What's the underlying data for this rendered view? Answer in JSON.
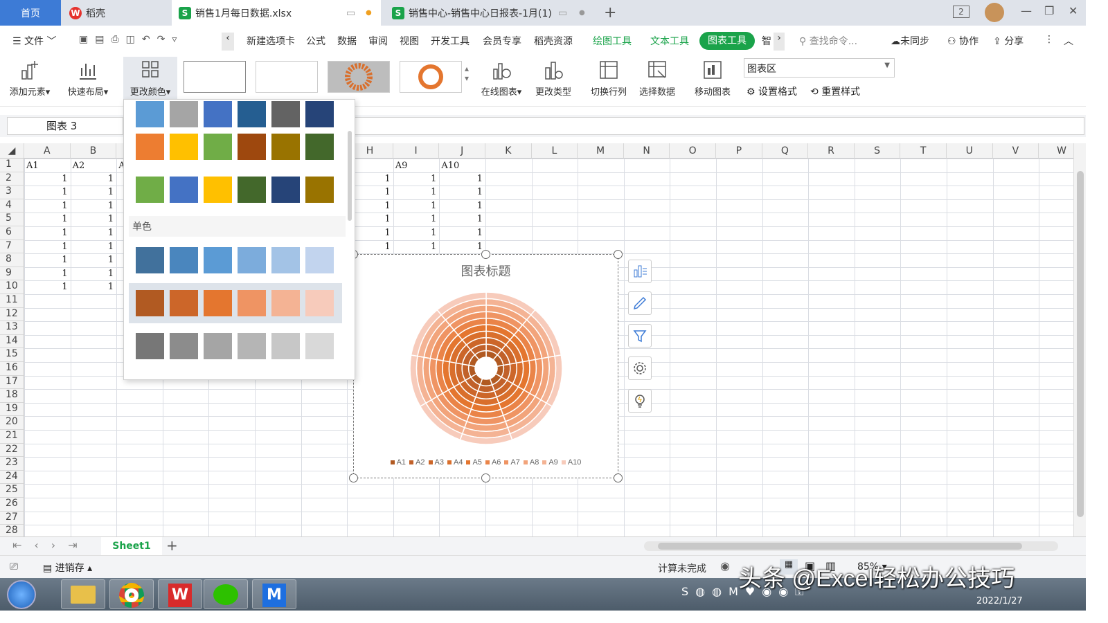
{
  "tabs": {
    "home": "首页",
    "daoke": "稻壳",
    "file1": "销售1月每日数据.xlsx",
    "file2": "销售中心-销售中心日报表-1月(1)",
    "add": "+"
  },
  "window": {
    "badge": "2"
  },
  "menu": {
    "file": "文件",
    "items": [
      "新建选项卡",
      "公式",
      "数据",
      "审阅",
      "视图",
      "开发工具",
      "会员专享",
      "稻壳资源"
    ],
    "draw_tools": "绘图工具",
    "text_tools": "文本工具",
    "chart_tools": "图表工具",
    "smart": "智",
    "search": "查找命令...",
    "unsync": "未同步",
    "collab": "协作",
    "share": "分享"
  },
  "ribbon": {
    "add_element": "添加元素",
    "quick_layout": "快速布局",
    "change_color": "更改颜色",
    "online_chart": "在线图表",
    "change_type": "更改类型",
    "switch_rowcol": "切换行列",
    "select_data": "选择数据",
    "move_chart": "移动图表",
    "chart_area": "图表区",
    "set_format": "设置格式",
    "reset_style": "重置样式"
  },
  "namebox": "图表 3",
  "columns": [
    "A",
    "B",
    "C",
    "D",
    "E",
    "F",
    "G",
    "H",
    "I",
    "J",
    "K",
    "L",
    "M",
    "N",
    "O",
    "P",
    "Q",
    "R",
    "S",
    "T",
    "U",
    "V",
    "W"
  ],
  "rows": [
    "1",
    "2",
    "3",
    "4",
    "5",
    "6",
    "7",
    "8",
    "9",
    "10",
    "11",
    "12",
    "13",
    "14",
    "15",
    "16",
    "17",
    "18",
    "19",
    "20",
    "21",
    "22",
    "23",
    "24",
    "25",
    "26",
    "27",
    "28"
  ],
  "cells": {
    "header_left": [
      "A1",
      "A2",
      "A"
    ],
    "header_right": [
      "8",
      "A9",
      "A10"
    ],
    "value": "1"
  },
  "dropdown": {
    "mono_label": "单色",
    "rows": [
      [
        "#5b9bd5",
        "#a5a5a5",
        "#4472c4",
        "#255e91",
        "#636363",
        "#264478"
      ],
      [
        "#ed7d31",
        "#ffc000",
        "#70ad47",
        "#9e480e",
        "#997300",
        "#43682b"
      ],
      [
        "#70ad47",
        "#4472c4",
        "#ffc000",
        "#43682b",
        "#264478",
        "#997300"
      ],
      [
        "#41719c",
        "#4a86be",
        "#5b9bd5",
        "#7cacdc",
        "#a3c3e6",
        "#c2d4ee"
      ],
      [
        "#b15a22",
        "#cc6629",
        "#e4762f",
        "#ef9463",
        "#f4b394",
        "#f7cbbb"
      ],
      [
        "#777777",
        "#8c8c8c",
        "#a5a5a5",
        "#b5b5b5",
        "#c7c7c7",
        "#d9d9d9"
      ]
    ]
  },
  "chart": {
    "title": "图表标题",
    "legend": [
      "A1",
      "A2",
      "A3",
      "A4",
      "A5",
      "A6",
      "A7",
      "A8",
      "A9",
      "A10"
    ],
    "ring_colors": [
      "#b15a22",
      "#c1612a",
      "#cc6629",
      "#d96f2c",
      "#e4762f",
      "#ea8448",
      "#ef9463",
      "#f2a47b",
      "#f4b394",
      "#f7cbbb"
    ]
  },
  "chart_data": {
    "type": "pie",
    "title": "图表标题",
    "categories": [
      "1",
      "2",
      "3",
      "4",
      "5",
      "6",
      "7",
      "8",
      "9"
    ],
    "series": [
      {
        "name": "A1",
        "values": [
          1,
          1,
          1,
          1,
          1,
          1,
          1,
          1,
          1
        ]
      },
      {
        "name": "A2",
        "values": [
          1,
          1,
          1,
          1,
          1,
          1,
          1,
          1,
          1
        ]
      },
      {
        "name": "A3",
        "values": [
          1,
          1,
          1,
          1,
          1,
          1,
          1,
          1,
          1
        ]
      },
      {
        "name": "A4",
        "values": [
          1,
          1,
          1,
          1,
          1,
          1,
          1,
          1,
          1
        ]
      },
      {
        "name": "A5",
        "values": [
          1,
          1,
          1,
          1,
          1,
          1,
          1,
          1,
          1
        ]
      },
      {
        "name": "A6",
        "values": [
          1,
          1,
          1,
          1,
          1,
          1,
          1,
          1,
          1
        ]
      },
      {
        "name": "A7",
        "values": [
          1,
          1,
          1,
          1,
          1,
          1,
          1,
          1,
          1
        ]
      },
      {
        "name": "A8",
        "values": [
          1,
          1,
          1,
          1,
          1,
          1,
          1,
          1,
          1
        ]
      },
      {
        "name": "A9",
        "values": [
          1,
          1,
          1,
          1,
          1,
          1,
          1,
          1,
          1
        ]
      },
      {
        "name": "A10",
        "values": [
          1,
          1,
          1,
          1,
          1,
          1,
          1,
          1,
          1
        ]
      }
    ],
    "legend_position": "bottom"
  },
  "sheet": {
    "tab": "Sheet1",
    "add": "+"
  },
  "status": {
    "macro": "进销存",
    "calc": "计算未完成",
    "zoom": "85%"
  },
  "watermark": "头条 @Excel轻松办公技巧",
  "clock": {
    "date": "2022/1/27"
  }
}
